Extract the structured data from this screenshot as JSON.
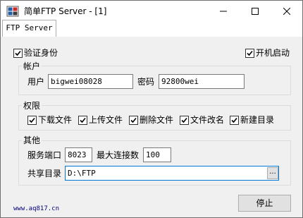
{
  "window": {
    "title": "简单FTP Server - [1]"
  },
  "titlebar_buttons": {
    "minimize_icon": "minimize-icon",
    "maximize_icon": "maximize-icon",
    "close_icon": "close-icon"
  },
  "tabs": [
    {
      "label": "FTP Server",
      "selected": true
    }
  ],
  "options": {
    "verify_identity": {
      "label": "验证身份",
      "checked": true
    },
    "autostart": {
      "label": "开机启动",
      "checked": true
    }
  },
  "account": {
    "title": "帐户",
    "user_label": "用户",
    "user_value": "bigwei08028",
    "password_label": "密码",
    "password_value": "92800wei"
  },
  "permissions": {
    "title": "权限",
    "items": [
      {
        "label": "下载文件",
        "checked": true
      },
      {
        "label": "上传文件",
        "checked": true
      },
      {
        "label": "删除文件",
        "checked": true
      },
      {
        "label": "文件改名",
        "checked": true
      },
      {
        "label": "新建目录",
        "checked": true
      }
    ]
  },
  "other": {
    "title": "其他",
    "port_label": "服务端口",
    "port_value": "8023",
    "maxconn_label": "最大连接数",
    "maxconn_value": "100",
    "share_label": "共享目录",
    "share_value": "D:\\FTP",
    "browse_label": "..."
  },
  "footer": {
    "link": "www.aq817.cn",
    "stop_label": "停止"
  },
  "colors": {
    "accent": "#0078d7",
    "link": "#000080",
    "icon_blue": "#1f5fa8",
    "icon_red": "#cc2a2a"
  }
}
